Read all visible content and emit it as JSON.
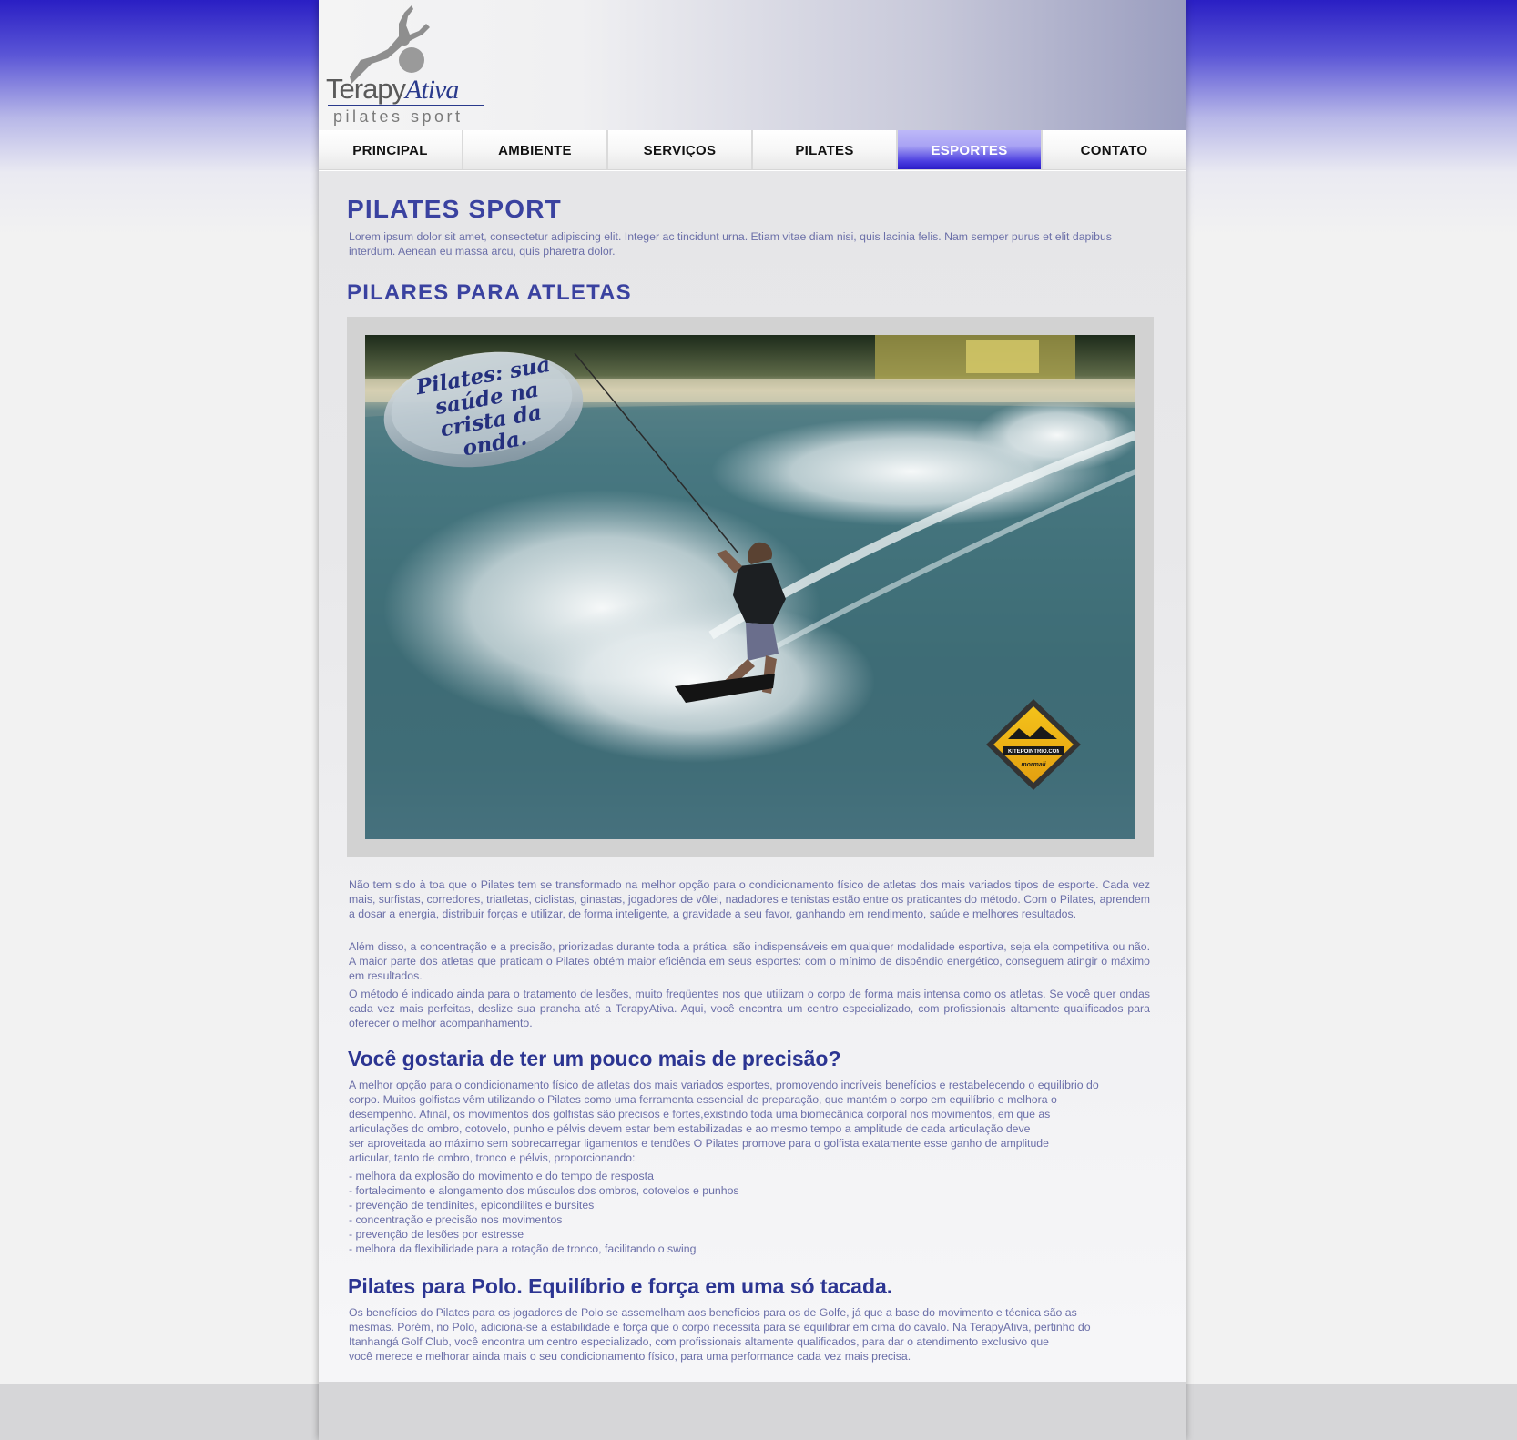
{
  "brand": {
    "logo_main": "Terapy",
    "logo_accent": "Ativa",
    "logo_sub": "pilates sport"
  },
  "nav": {
    "items": [
      "PRINCIPAL",
      "AMBIENTE",
      "SERVIÇOS",
      "PILATES",
      "ESPORTES",
      "CONTATO"
    ],
    "active": "ESPORTES"
  },
  "colors": {
    "accent": "#2c3592",
    "body_text": "#6b6fa8",
    "nav_active": "#4a3de0"
  },
  "main": {
    "title": "PILATES SPORT",
    "intro": "Lorem ipsum dolor sit amet, consectetur adipiscing elit. Integer ac tincidunt urna. Etiam vitae diam nisi, quis lacinia felis. Nam semper purus et elit dapibus interdum. Aenean eu massa arcu, quis pharetra dolor.",
    "section_title": "PILARES PARA ATLETAS",
    "photo": {
      "bubble_text": "Pilates: sua saúde na crista da onda.",
      "badge_text_1": "KITEPOINTRIO.COM",
      "badge_text_2": "mormaii"
    },
    "paragraphs": [
      "Não tem sido à toa que o Pilates tem se transformado na melhor opção para o condicionamento físico de atletas dos mais variados tipos de esporte. Cada vez mais, surfistas, corredores, triatletas, ciclistas, ginastas, jogadores de vôlei, nadadores e tenistas estão entre os praticantes do método. Com o Pilates, aprendem a dosar a energia, distribuir forças e utilizar, de forma inteligente, a gravidade a seu favor, ganhando em rendimento, saúde e melhores resultados.",
      "Além disso, a concentração e a precisão, priorizadas durante toda a prática, são indispensáveis em qualquer modalidade esportiva, seja ela competitiva ou não. A maior parte dos atletas que praticam o Pilates obtém maior eficiência em seus esportes: com o mínimo de dispêndio energético, conseguem atingir o máximo em resultados.",
      "O método é indicado ainda para o tratamento de lesões, muito freqüentes nos que utilizam o corpo de forma mais intensa como os atletas. Se você quer ondas cada vez mais perfeitas, deslize sua prancha até a TerapyAtiva. Aqui, você encontra um centro especializado, com profissionais altamente qualificados para oferecer o melhor acompanhamento."
    ],
    "golf": {
      "title": "Você gostaria de ter um pouco mais de precisão?",
      "lines": [
        "A melhor opção para o condicionamento físico de atletas dos mais variados esportes, promovendo incríveis benefícios e restabelecendo o equilíbrio do",
        "corpo. Muitos golfistas vêm utilizando o Pilates como uma ferramenta essencial de preparação, que mantém o corpo em equilíbrio e melhora o",
        "desempenho. Afinal, os movimentos dos golfistas são precisos e fortes,existindo toda uma biomecânica corporal nos movimentos, em que as",
        "articulações do ombro, cotovelo, punho e pélvis devem estar bem estabilizadas e ao mesmo tempo a amplitude de cada articulação deve",
        "ser aproveitada ao máximo sem sobrecarregar ligamentos e tendões O Pilates promove para o golfista exatamente esse ganho de amplitude",
        "articular, tanto de ombro, tronco e pélvis, proporcionando:"
      ],
      "bullets": [
        "- melhora da explosão do movimento e do tempo de resposta",
        "- fortalecimento e alongamento dos músculos dos ombros, cotovelos e punhos",
        "- prevenção de tendinites, epicondilites e bursites",
        "- concentração e precisão nos movimentos",
        "- prevenção de lesões por estresse",
        "- melhora da flexibilidade para a rotação de tronco, facilitando o swing"
      ]
    },
    "polo": {
      "title": "Pilates para Polo. Equilíbrio e força em uma só tacada.",
      "lines": [
        "Os benefícios do Pilates para os jogadores de Polo se assemelham aos benefícios para os de Golfe, já que a base do movimento e técnica são as",
        "mesmas. Porém, no Polo, adiciona-se a estabilidade e força que o corpo necessita para se equilibrar em cima do cavalo. Na TerapyAtiva, pertinho do",
        "Itanhangá Golf Club, você encontra um centro especializado, com profissionais altamente qualificados, para dar o atendimento exclusivo que",
        "você merece e melhorar ainda mais o seu condicionamento físico, para uma performance cada vez mais precisa."
      ]
    }
  }
}
